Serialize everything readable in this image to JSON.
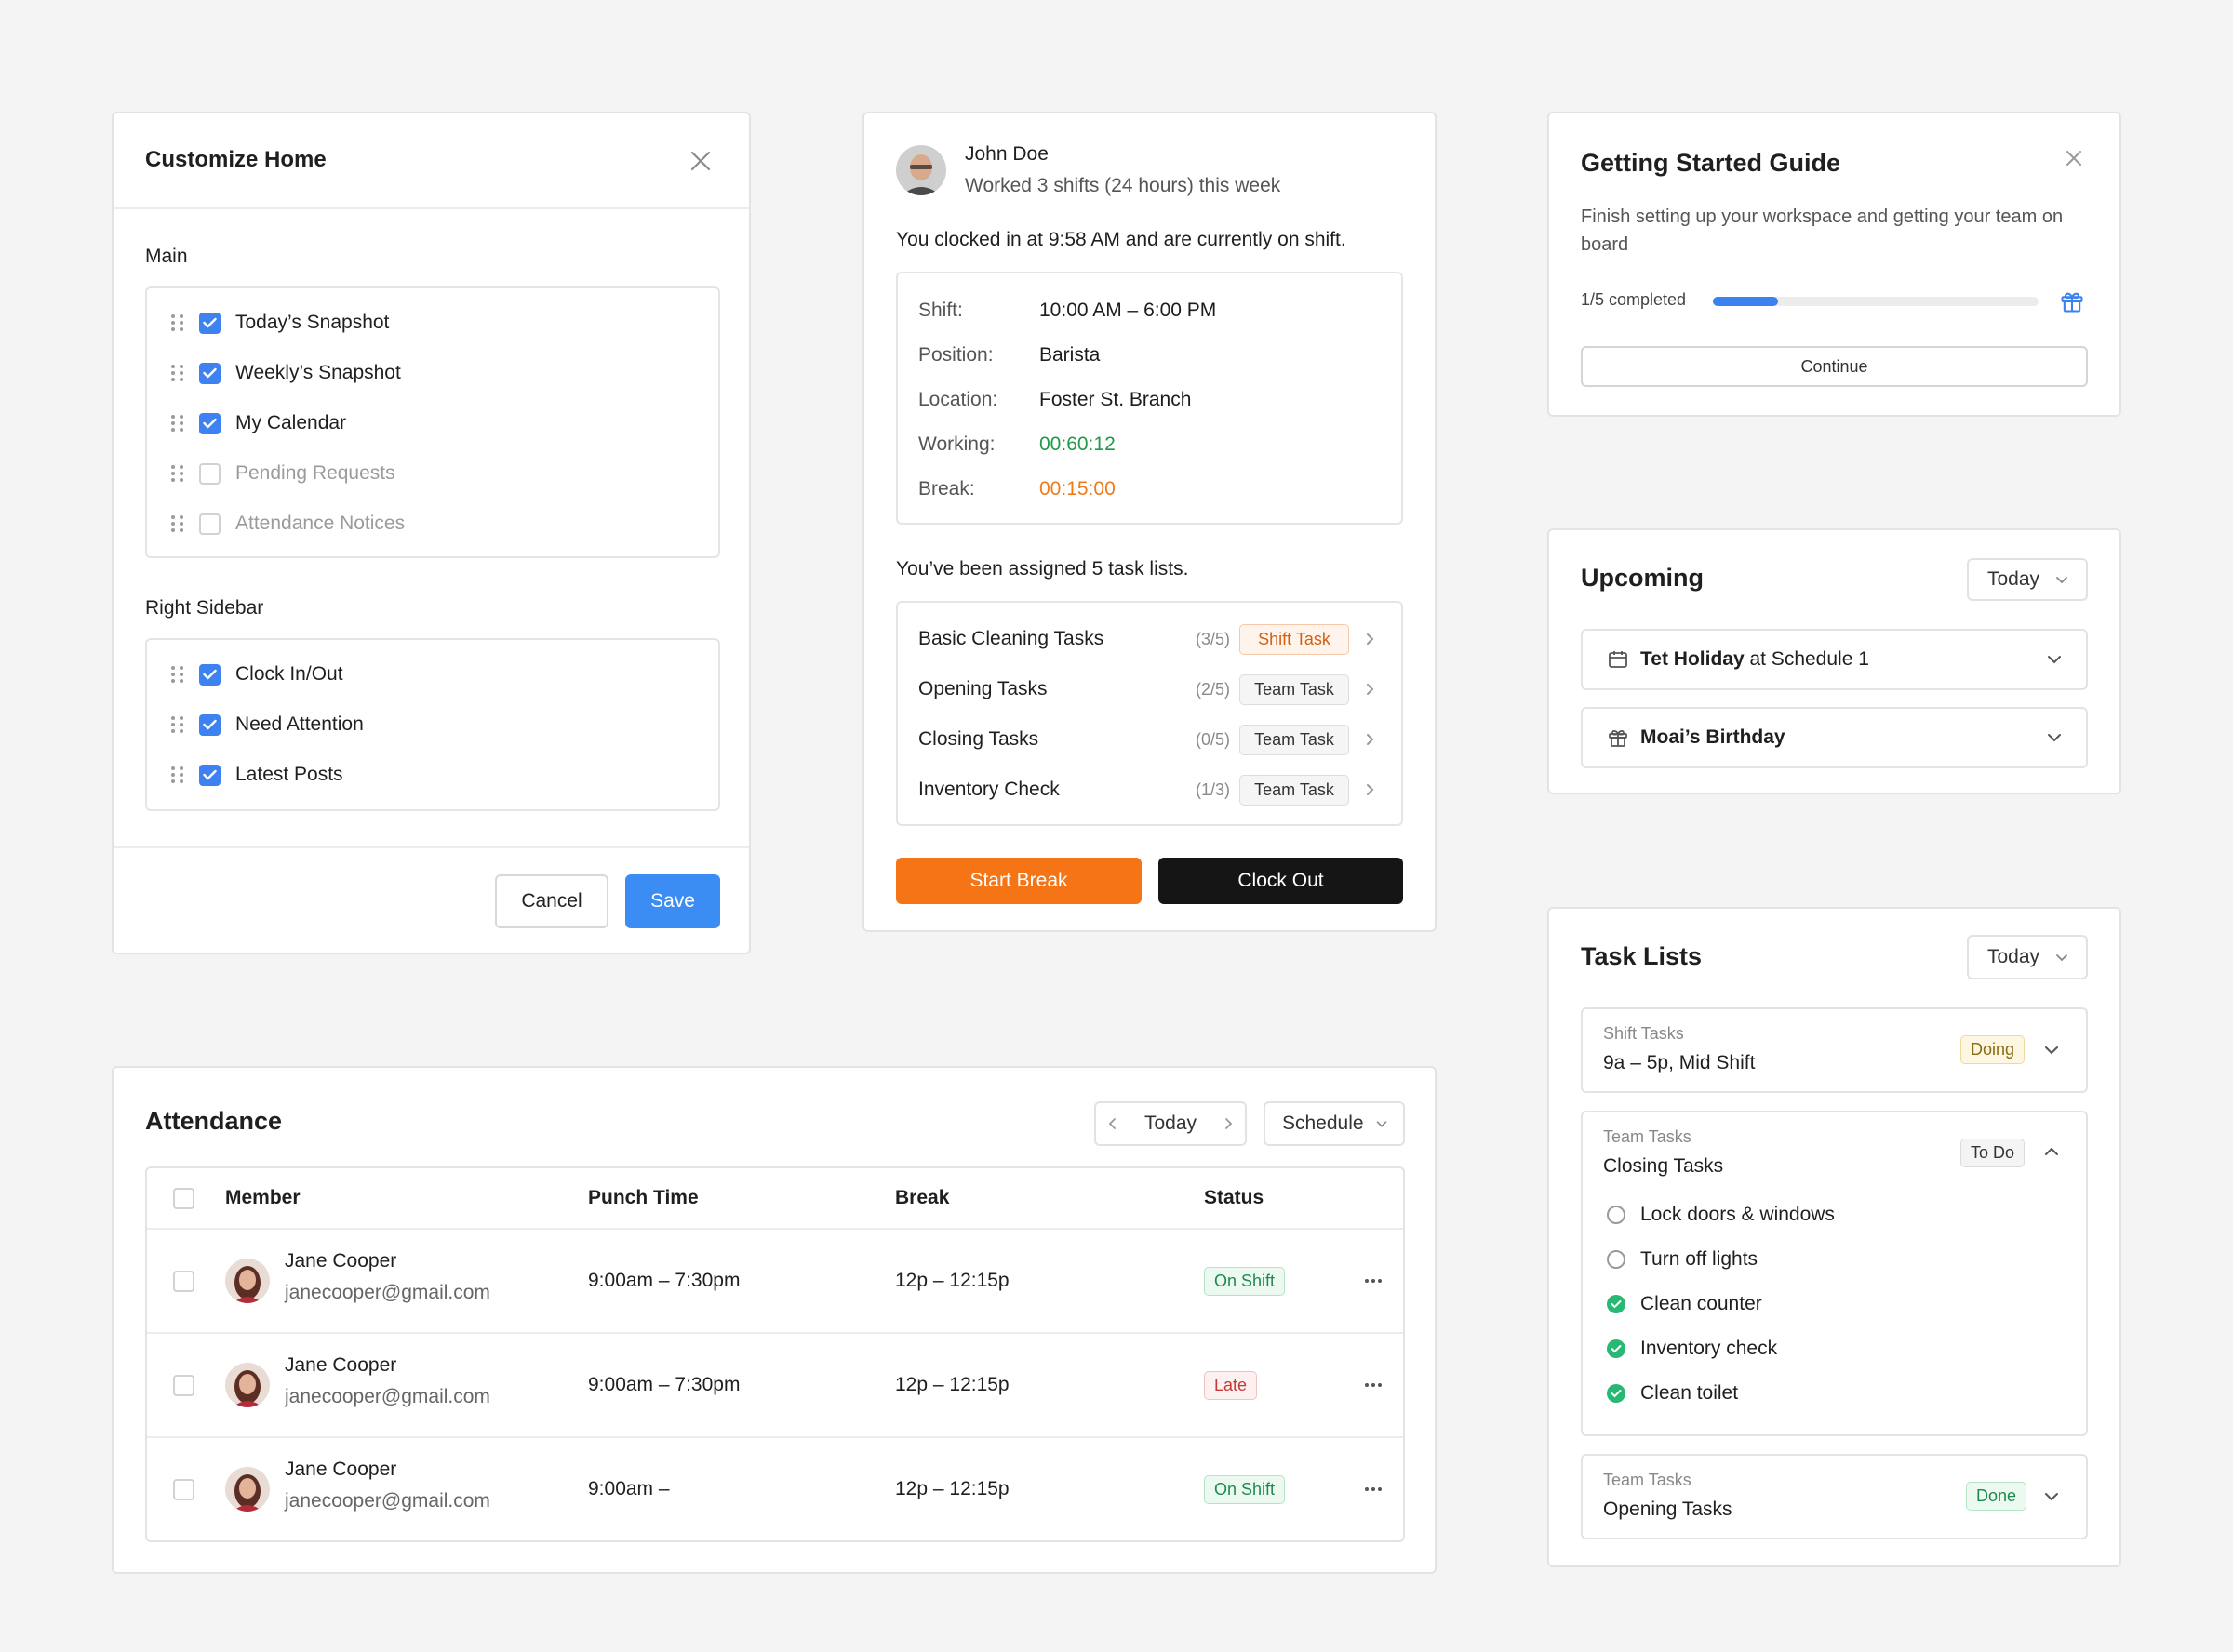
{
  "customize": {
    "title": "Customize Home",
    "main_label": "Main",
    "main_items": [
      {
        "label": "Today’s Snapshot",
        "checked": true
      },
      {
        "label": "Weekly’s Snapshot",
        "checked": true
      },
      {
        "label": "My Calendar",
        "checked": true
      },
      {
        "label": "Pending Requests",
        "checked": false
      },
      {
        "label": "Attendance Notices",
        "checked": false
      }
    ],
    "sidebar_label": "Right Sidebar",
    "sidebar_items": [
      {
        "label": "Clock In/Out",
        "checked": true
      },
      {
        "label": "Need Attention",
        "checked": true
      },
      {
        "label": "Latest Posts",
        "checked": true
      }
    ],
    "cancel": "Cancel",
    "save": "Save"
  },
  "clock": {
    "name": "John Doe",
    "subtitle": "Worked 3 shifts (24 hours) this week",
    "status": "You clocked in at 9:58 AM and are currently on shift.",
    "details": [
      {
        "key": "Shift:",
        "value": "10:00 AM – 6:00 PM",
        "color": "#1c1c1c"
      },
      {
        "key": "Position:",
        "value": "Barista",
        "color": "#1c1c1c"
      },
      {
        "key": "Location:",
        "value": "Foster St. Branch",
        "color": "#1c1c1c"
      },
      {
        "key": "Working:",
        "value": "00:60:12",
        "color": "#1e9a4a"
      },
      {
        "key": "Break:",
        "value": "00:15:00",
        "color": "#ef7a1a"
      }
    ],
    "assigned": "You’ve been assigned 5 task lists.",
    "tasks": [
      {
        "name": "Basic Cleaning Tasks",
        "count": "(3/5)",
        "tag": "Shift Task",
        "kind": "shift"
      },
      {
        "name": "Opening Tasks",
        "count": "(2/5)",
        "tag": "Team Task",
        "kind": "team"
      },
      {
        "name": "Closing Tasks",
        "count": "(0/5)",
        "tag": "Team Task",
        "kind": "team"
      },
      {
        "name": "Inventory Check",
        "count": "(1/3)",
        "tag": "Team Task",
        "kind": "team"
      }
    ],
    "start_break": "Start Break",
    "clock_out": "Clock Out"
  },
  "guide": {
    "title": "Getting Started Guide",
    "desc": "Finish setting up your workspace and getting your team on board",
    "progress_label": "1/5 completed",
    "progress": 0.2,
    "continue": "Continue"
  },
  "upcoming": {
    "title": "Upcoming",
    "filter": "Today",
    "items": [
      {
        "pre": "Tet Holiday",
        "post": " at Schedule 1",
        "icon": "calendar-icon"
      },
      {
        "pre": "Moai’s Birthday",
        "post": "",
        "icon": "gift-icon"
      }
    ]
  },
  "tasklists": {
    "title": "Task Lists",
    "filter": "Today",
    "shift": {
      "type": "Shift Tasks",
      "name": "9a – 5p, Mid Shift",
      "status": "Doing"
    },
    "closing": {
      "type": "Team Tasks",
      "name": "Closing Tasks",
      "status": "To Do",
      "items": [
        {
          "label": "Lock doors & windows",
          "done": false
        },
        {
          "label": "Turn off lights",
          "done": false
        },
        {
          "label": "Clean counter",
          "done": true
        },
        {
          "label": "Inventory check",
          "done": true
        },
        {
          "label": "Clean toilet",
          "done": true
        }
      ]
    },
    "opening": {
      "type": "Team Tasks",
      "name": "Opening Tasks",
      "status": "Done"
    }
  },
  "attendance": {
    "title": "Attendance",
    "date": "Today",
    "view": "Schedule",
    "columns": [
      "Member",
      "Punch Time",
      "Break",
      "Status"
    ],
    "rows": [
      {
        "name": "Jane Cooper",
        "email": "janecooper@gmail.com",
        "punch": "9:00am – 7:30pm",
        "break": "12p – 12:15p",
        "status": "On Shift",
        "kind": "onshift"
      },
      {
        "name": "Jane Cooper",
        "email": "janecooper@gmail.com",
        "punch": "9:00am – 7:30pm",
        "break": "12p – 12:15p",
        "status": "Late",
        "kind": "late"
      },
      {
        "name": "Jane Cooper",
        "email": "janecooper@gmail.com",
        "punch": "9:00am –",
        "break": "12p – 12:15p",
        "status": "On Shift",
        "kind": "onshift"
      }
    ]
  }
}
